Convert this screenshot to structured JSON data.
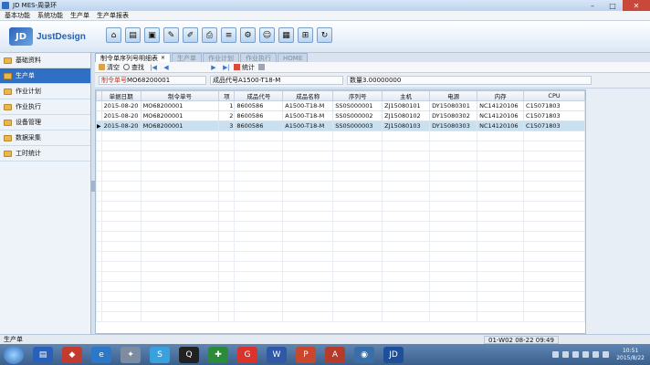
{
  "window": {
    "title": "JD MES-周录环"
  },
  "menu": [
    "基本功能",
    "系统功能",
    "生产单",
    "生产单报表"
  ],
  "logo": {
    "mark": "JD",
    "text": "JustDesign"
  },
  "toolbar_icons": [
    "home-icon",
    "document-icon",
    "monitor-icon",
    "edit-icon",
    "pencil-icon",
    "print-icon",
    "list-icon",
    "settings-icon",
    "user-icon",
    "report-icon",
    "network-icon",
    "refresh-icon"
  ],
  "sidebar": {
    "items": [
      {
        "label": "基础资料",
        "active": false
      },
      {
        "label": "生产单",
        "active": true
      },
      {
        "label": "作业计划",
        "active": false
      },
      {
        "label": "作业执行",
        "active": false
      },
      {
        "label": "设备管理",
        "active": false
      },
      {
        "label": "数据采集",
        "active": false
      },
      {
        "label": "工时统计",
        "active": false
      }
    ]
  },
  "tabs": [
    {
      "label": "制令单序列号明细表",
      "active": true,
      "closable": true
    },
    {
      "label": "生产单",
      "active": false
    },
    {
      "label": "作业计划",
      "active": false
    },
    {
      "label": "作业执行",
      "active": false
    },
    {
      "label": "HOME",
      "active": false
    }
  ],
  "actions": {
    "clear": "清空",
    "find": "查找",
    "stats": "统计"
  },
  "filters": {
    "order_label": "制令单号",
    "order_value": "MO68200001",
    "product_label": "成品代号",
    "product_value": "A1500-T18-M",
    "qty_label": "数量",
    "qty_value": "3.00000000"
  },
  "table": {
    "columns": [
      "单据日期",
      "制令单号",
      "项",
      "成品代号",
      "成品名称",
      "序列号",
      "主机",
      "电源",
      "内存",
      "CPU"
    ],
    "rows": [
      [
        "2015-08-20",
        "MO68200001",
        "1",
        "8600586",
        "A1500-T18-M",
        "SS0S000001",
        "ZJ15080101",
        "DY15080301",
        "NC14120106",
        "C15071803"
      ],
      [
        "2015-08-20",
        "MO68200001",
        "2",
        "8600586",
        "A1500-T18-M",
        "SS0S000002",
        "ZJ15080102",
        "DY15080302",
        "NC14120106",
        "C15071803"
      ],
      [
        "2015-08-20",
        "MO68200001",
        "3",
        "8600586",
        "A1500-T18-M",
        "SS0S000003",
        "ZJ15080103",
        "DY15080303",
        "NC14120106",
        "C15071803"
      ]
    ],
    "selected_row": 2
  },
  "status": {
    "left": "生产单",
    "right": "01-W02 08-22 09:49"
  },
  "taskbar": {
    "time": "10:51",
    "date": "2015/8/22"
  }
}
